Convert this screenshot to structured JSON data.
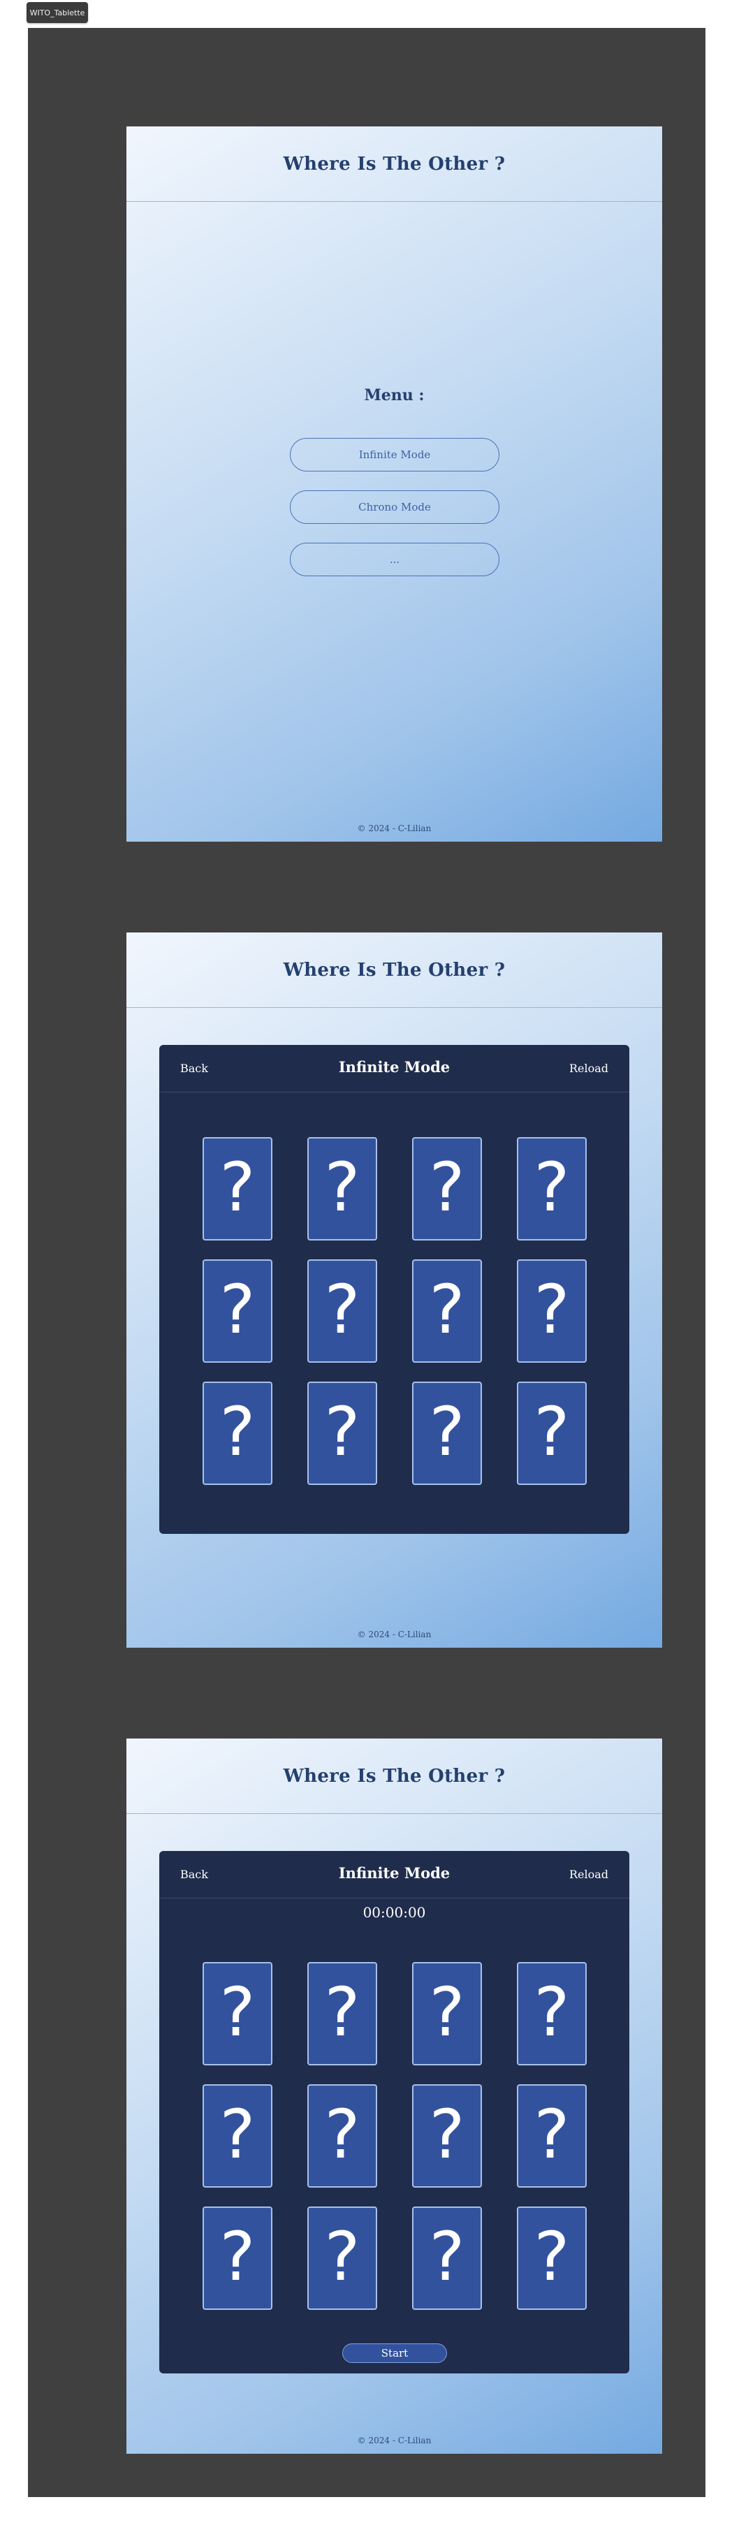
{
  "frame_label": "WITO_Tablette",
  "app": {
    "title": "Where Is The Other ?",
    "footer": "© 2024 - C-Lilian"
  },
  "menu_screen": {
    "heading": "Menu :",
    "buttons": [
      "Infinite Mode",
      "Chrono Mode",
      "..."
    ]
  },
  "infinite_screen": {
    "back_label": "Back",
    "title": "Infinite Mode",
    "reload_label": "Reload",
    "card_symbol": "?",
    "card_count": 12
  },
  "chrono_screen": {
    "back_label": "Back",
    "title": "Infinite Mode",
    "reload_label": "Reload",
    "timer": "00:00:00",
    "card_symbol": "?",
    "card_count": 12,
    "start_label": "Start"
  }
}
